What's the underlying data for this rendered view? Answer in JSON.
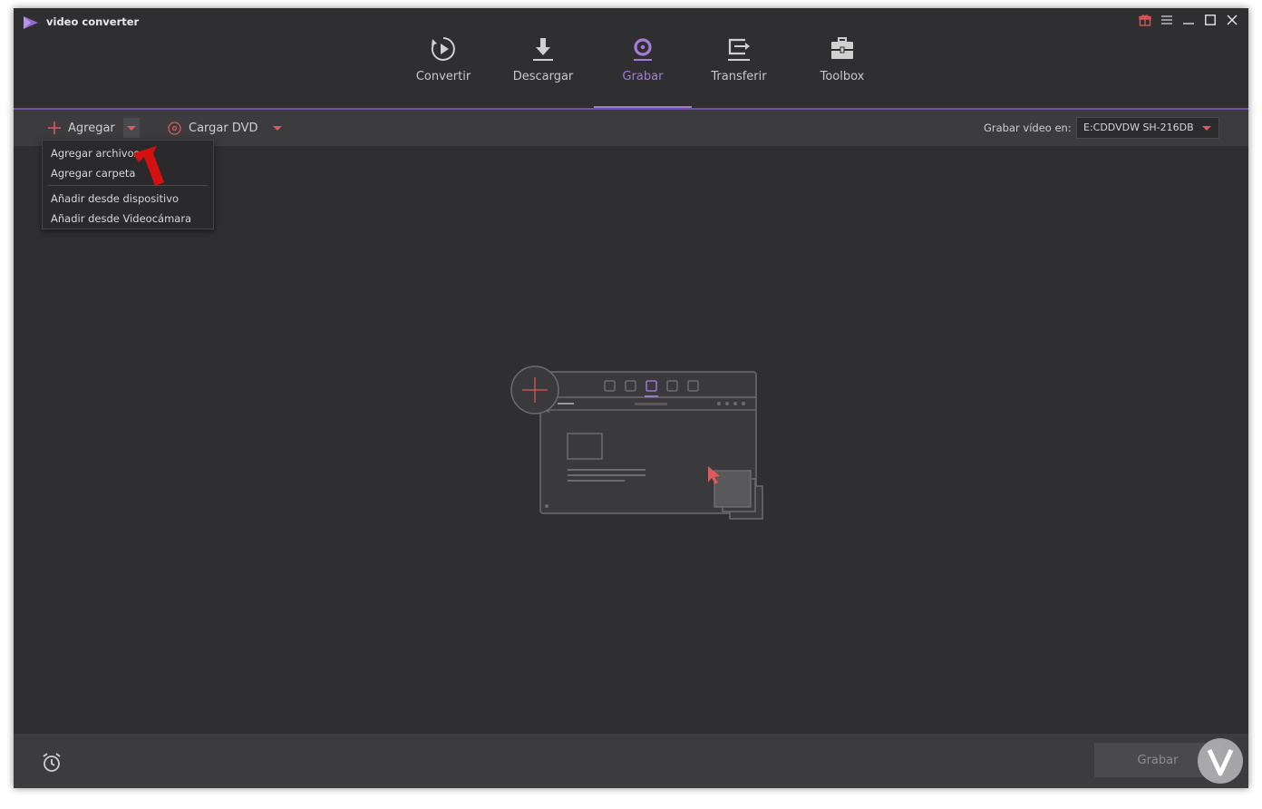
{
  "app": {
    "title": "video converter"
  },
  "nav": {
    "items": [
      {
        "label": "Convertir",
        "icon": "convert-icon"
      },
      {
        "label": "Descargar",
        "icon": "download-icon"
      },
      {
        "label": "Grabar",
        "icon": "burn-icon"
      },
      {
        "label": "Transferir",
        "icon": "transfer-icon"
      },
      {
        "label": "Toolbox",
        "icon": "toolbox-icon"
      }
    ],
    "active": "Grabar"
  },
  "toolbar": {
    "add_label": "Agregar",
    "load_dvd_label": "Cargar DVD",
    "burn_to_label": "Grabar vídeo en:",
    "burn_to_value": "E:CDDVDW SH-216DB"
  },
  "dropdown": {
    "items": [
      "Agregar archivos...",
      "Agregar carpeta",
      "Añadir desde dispositivo",
      "Añadir desde Videocámara"
    ]
  },
  "footer": {
    "burn_button_label": "Grabar"
  },
  "colors": {
    "accent": "#a47cd8",
    "add_red": "#e0585a",
    "window_bg": "#2f2f31",
    "toolbar_bg": "#3c3b3d"
  }
}
